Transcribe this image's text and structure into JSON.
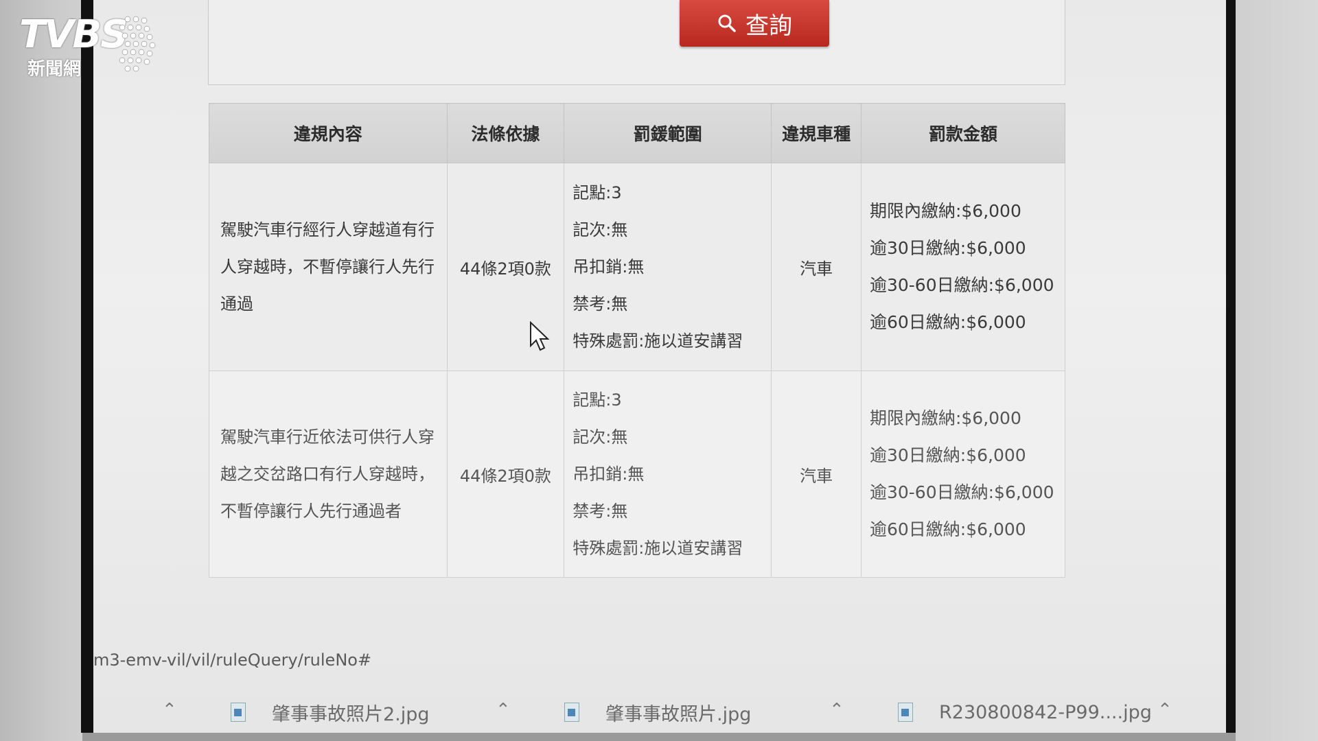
{
  "logo": {
    "brand": "TVBS",
    "sub": "新聞網"
  },
  "search": {
    "button_label": "查詢",
    "icon": "search-icon"
  },
  "table": {
    "headers": [
      "違規內容",
      "法條依據",
      "罰鍰範圍",
      "違規車種",
      "罰款金額"
    ],
    "rows": [
      {
        "content": "駕駛汽車行經行人穿越道有行人穿越時，不暫停讓行人先行通過",
        "law": "44條2項0款",
        "penalty": [
          "記點:3",
          "記次:無",
          "吊扣銷:無",
          "禁考:無",
          "特殊處罰:施以道安講習"
        ],
        "vehicle": "汽車",
        "amount": [
          "期限內繳納:$6,000",
          "逾30日繳納:$6,000",
          "逾30-60日繳納:$6,000",
          "逾60日繳納:$6,000"
        ]
      },
      {
        "content": "駕駛汽車行近依法可供行人穿越之交岔路口有行人穿越時，不暫停讓行人先行通過者",
        "law": "44條2項0款",
        "penalty": [
          "記點:3",
          "記次:無",
          "吊扣銷:無",
          "禁考:無",
          "特殊處罰:施以道安講習"
        ],
        "vehicle": "汽車",
        "amount": [
          "期限內繳納:$6,000",
          "逾30日繳納:$6,000",
          "逾30-60日繳納:$6,000",
          "逾60日繳納:$6,000"
        ]
      }
    ]
  },
  "status_url": "m3-emv-vil/vil/ruleQuery/ruleNo#",
  "downloads": [
    {
      "name": "肇事事故照片2.jpg"
    },
    {
      "name": "肇事事故照片.jpg"
    },
    {
      "name": "R230800842-P99....jpg"
    }
  ]
}
